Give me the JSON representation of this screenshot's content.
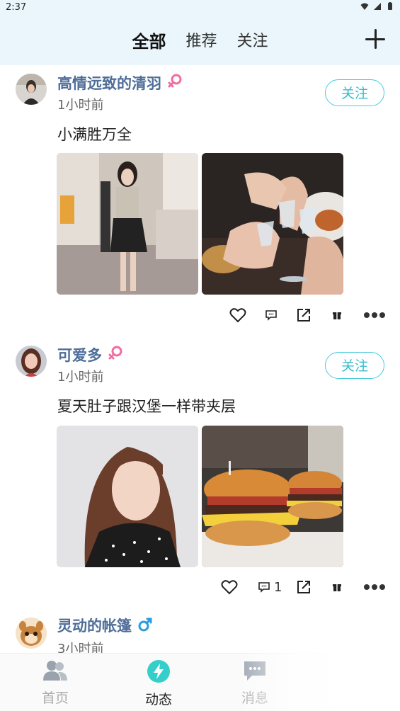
{
  "status": {
    "time": "2:37"
  },
  "tabs": [
    {
      "label": "全部",
      "active": true
    },
    {
      "label": "推荐",
      "active": false
    },
    {
      "label": "关注",
      "active": false
    }
  ],
  "posts": [
    {
      "username": "高情远致的清羽",
      "gender": "female",
      "time": "1小时前",
      "content": "小满胜万全",
      "follow_label": "关注",
      "comment_count": "",
      "photos": [
        "mirror-selfie-photo",
        "toast-glasses-photo"
      ]
    },
    {
      "username": "可爱多",
      "gender": "female",
      "time": "1小时前",
      "content": "夏天肚子跟汉堡一样带夹层",
      "follow_label": "关注",
      "comment_count": "1",
      "photos": [
        "portrait-photo",
        "burgers-photo"
      ]
    },
    {
      "username": "灵动的帐篷",
      "gender": "male",
      "time": "3小时前"
    }
  ],
  "bottom_nav": [
    {
      "label": "首页",
      "icon": "people-icon",
      "active": false
    },
    {
      "label": "动态",
      "icon": "lightning-icon",
      "active": true
    },
    {
      "label": "消息",
      "icon": "chat-icon",
      "active": false
    }
  ],
  "colors": {
    "accent": "#47cbd9",
    "username": "#4f6e99",
    "female": "#f06fa0",
    "male": "#2a9de0",
    "top_bg": "#eaf6fb"
  }
}
